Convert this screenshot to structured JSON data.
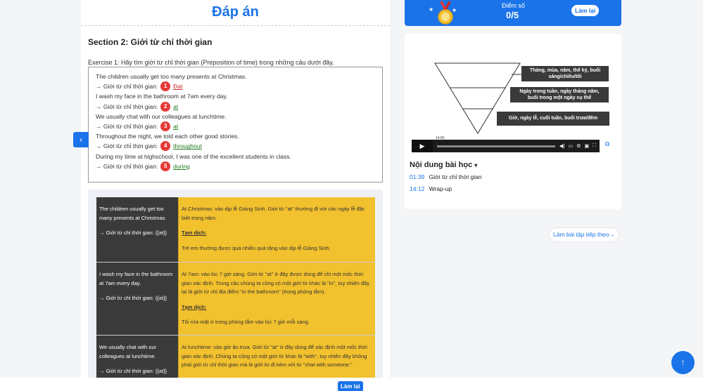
{
  "main": {
    "answer_title": "Đáp án",
    "section_title": "Section 2: Giới từ chỉ thời gian",
    "exercise_text": "Exercise 1: Hãy tìm giới từ chỉ thời gian (Preposition of time) trong những câu dưới đây.",
    "answer_prefix": "→ Giới từ chỉ thời gian:",
    "questions": [
      {
        "sentence": "The children usually get too many presents at Christmas.",
        "num": "1",
        "answer": "Đat",
        "answer_color": "#c62828"
      },
      {
        "sentence": "I wash my face in the bathroom at 7am every day.",
        "num": "2",
        "answer": "at",
        "answer_color": "#1f7a1f"
      },
      {
        "sentence": "We usually chat with our colleagues at lunchtime.",
        "num": "3",
        "answer": "at",
        "answer_color": "#1f7a1f"
      },
      {
        "sentence": "Throughout the night, we told each other good stories.",
        "num": "4",
        "answer": "throughout",
        "answer_color": "#1f7a1f"
      },
      {
        "sentence": "During my time at highschool, I was one of the excellent students in class.",
        "num": "5",
        "answer": "during",
        "answer_color": "#1f7a1f"
      }
    ],
    "explanations": [
      {
        "left_sentence": "The children usually get too many presents at Christmas.",
        "left_answer": "→ Giới từ chỉ thời gian: {{at}}",
        "right_text": "At Christmas: vào dịp lễ Giáng Sinh. Giới từ \"at\" thường đi với các ngày lễ đặc biệt trong năm.",
        "translation_label": "Tạm dịch:",
        "translation": "Trẻ em thường được quá nhiều quà tặng vào dịp lễ Giáng Sinh."
      },
      {
        "left_sentence": "I wash my face in the bathroom at 7am every day.",
        "left_answer": "→ Giới từ chỉ thời gian: {{at}}",
        "right_text": "At 7am: vào lúc 7 giờ sáng. Giới từ \"at\" ở đây được dùng để chỉ một mốc thời gian xác định. Trong câu chúng ta cũng có một giới từ khác là \"in\", tuy nhiên đây lại là giới từ chỉ địa điểm \"in the bathroom\" (trong phòng tắm).",
        "translation_label": "Tạm dịch:",
        "translation": "Tôi rửa mặt ở trong phòng tắm vào lúc 7 giờ mỗi sáng."
      },
      {
        "left_sentence": "We usually chat with our colleagues at lunchtime.",
        "left_answer": "→ Giới từ chỉ thời gian: {{at}}",
        "right_text": "At lunchtime: vào giờ ăn trưa. Giới từ \"at\" ở đây dùng để xác định một mốc thời gian xác định. Chúng ta cũng có một giới từ khác là \"with\", tuy nhiên đây không phải giới từ chỉ thời gian mà là giới từ đi kèm với từ \"chat with someone.\"",
        "translation_label": "",
        "translation": ""
      }
    ]
  },
  "score": {
    "label": "Điểm số",
    "value": "0/5",
    "redo_label": "Làm lại"
  },
  "video": {
    "pyramid_labels": [
      "Tháng, mùa, năm, thế kỷ, buổi sáng/chiều/tối",
      "Ngày trong tuần, ngày tháng năm, buổi trong một ngày cụ thể",
      "Giờ, ngày lễ, cuối tuần, buổi trưa/đêm"
    ],
    "time_tip": "14:55",
    "toc_title": "Nội dung bài học",
    "toc_items": [
      {
        "time": "01:39",
        "label": "Giới từ chỉ thời gian"
      },
      {
        "time": "14:12",
        "label": "Wrap-up"
      }
    ]
  },
  "next_button": "Làm bài tập tiếp theo→",
  "bottom_redo": "Làm lại",
  "colors": {
    "accent": "#1a73e8",
    "highlight": "#f2c12e",
    "dark_cell": "#3a3a3a",
    "badge_red": "#e53935"
  }
}
